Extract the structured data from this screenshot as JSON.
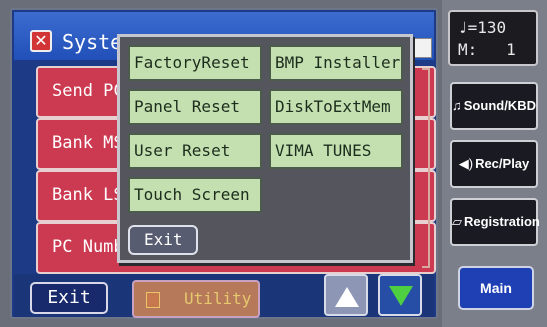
{
  "window": {
    "title": "Syste",
    "icon_glyph": "✕"
  },
  "list": {
    "rows": [
      "Send PC",
      "Bank MS",
      "Bank LS",
      "PC Numb"
    ]
  },
  "popup": {
    "buttons": [
      "FactoryReset",
      "BMP Installer",
      "Panel Reset",
      "DiskToExtMem",
      "User Reset",
      "VIMA TUNES",
      "Touch Screen"
    ],
    "exit_label": "Exit"
  },
  "bottom": {
    "exit_label": "Exit",
    "utility_label": "Utility"
  },
  "status": {
    "tempo": "♩=130",
    "measure": "M:   1"
  },
  "side": {
    "sound_kbd": "Sound/KBD",
    "rec_play": "Rec/Play",
    "registration": "Registration",
    "main": "Main"
  },
  "colors": {
    "accent_green": "#4ecf42",
    "list_red": "#cc3a52",
    "screen_blue": "#1c3a85"
  },
  "icons": [
    "music-note-icon",
    "speaker-icon",
    "registration-book-icon",
    "up-arrow-icon",
    "down-arrow-icon",
    "system-icon"
  ]
}
